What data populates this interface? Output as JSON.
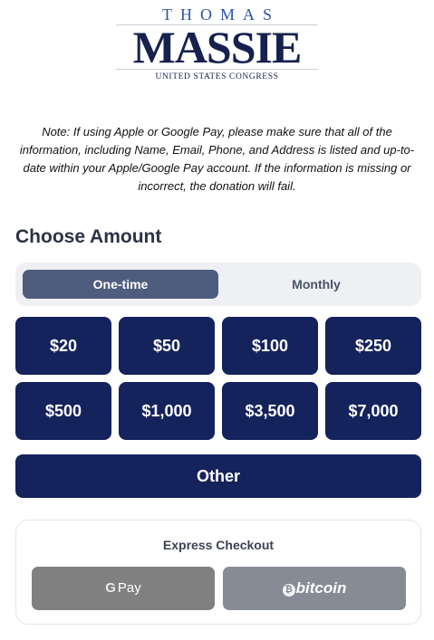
{
  "logo": {
    "top_text": "THOMAS",
    "main_text": "MASSIE",
    "sub_text": "UNITED STATES CONGRESS",
    "colors": {
      "top": "#2b55a3",
      "main": "#17214f"
    }
  },
  "note": "Note: If using Apple or Google Pay, please make sure that all of the information, including Name, Email, Phone, and Address is listed and up-to-date within your Apple/Google Pay account. If the information is missing or incorrect, the donation will fail.",
  "amount_section": {
    "heading": "Choose Amount",
    "frequency": {
      "options": [
        "One-time",
        "Monthly"
      ],
      "selected": "One-time"
    },
    "amounts": [
      "$20",
      "$50",
      "$100",
      "$250",
      "$500",
      "$1,000",
      "$3,500",
      "$7,000"
    ],
    "other_label": "Other"
  },
  "express_checkout": {
    "title": "Express Checkout",
    "gpay": {
      "icon": "google-g-icon",
      "label": "Pay"
    },
    "bitcoin": {
      "icon": "bitcoin-icon",
      "label": "bitcoin"
    }
  },
  "colors": {
    "button_primary": "#15235c",
    "toggle_active": "#4e5c7e",
    "toggle_bg": "#eef0f4",
    "gpay_bg": "#808080",
    "bitcoin_bg": "#868b96"
  }
}
